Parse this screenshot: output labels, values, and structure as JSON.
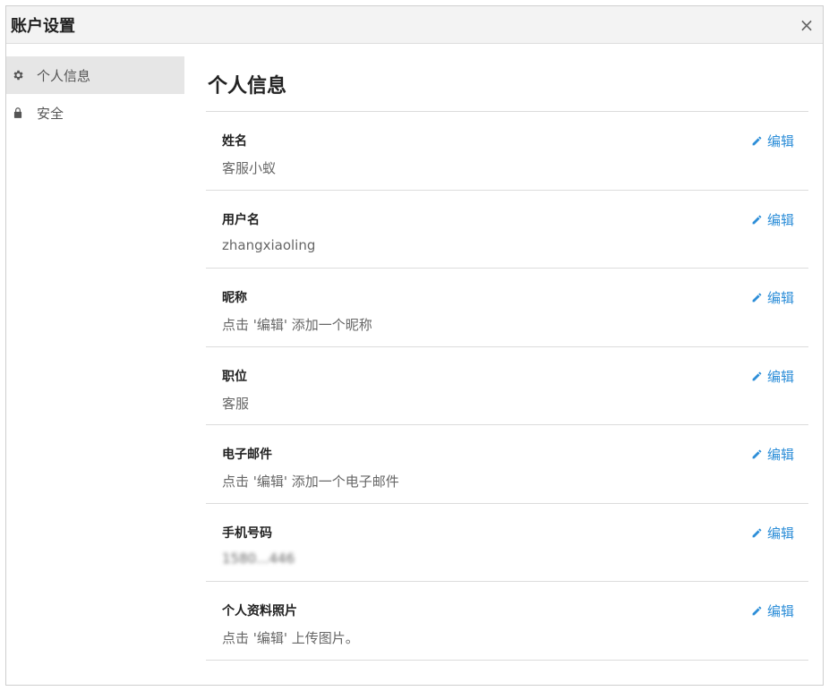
{
  "dialog": {
    "title": "账户设置",
    "close_symbol": "×"
  },
  "sidebar": {
    "items": [
      {
        "label": "个人信息",
        "icon": "gear-icon",
        "active": true
      },
      {
        "label": "安全",
        "icon": "lock-icon",
        "active": false
      }
    ]
  },
  "main": {
    "heading": "个人信息",
    "edit_label": "编辑",
    "rows": [
      {
        "label": "姓名",
        "value": "客服小蚁"
      },
      {
        "label": "用户名",
        "value": "zhangxiaoling"
      },
      {
        "label": "昵称",
        "value": "点击 '编辑' 添加一个昵称"
      },
      {
        "label": "职位",
        "value": "客服"
      },
      {
        "label": "电子邮件",
        "value": "点击 '编辑' 添加一个电子邮件"
      },
      {
        "label": "手机号码",
        "value": "1580...446"
      },
      {
        "label": "个人资料照片",
        "value": "点击 '编辑' 上传图片。"
      }
    ]
  },
  "colors": {
    "accent": "#2d8ed8",
    "active_bg": "#e6e6e6",
    "header_bg": "#f3f3f3"
  }
}
